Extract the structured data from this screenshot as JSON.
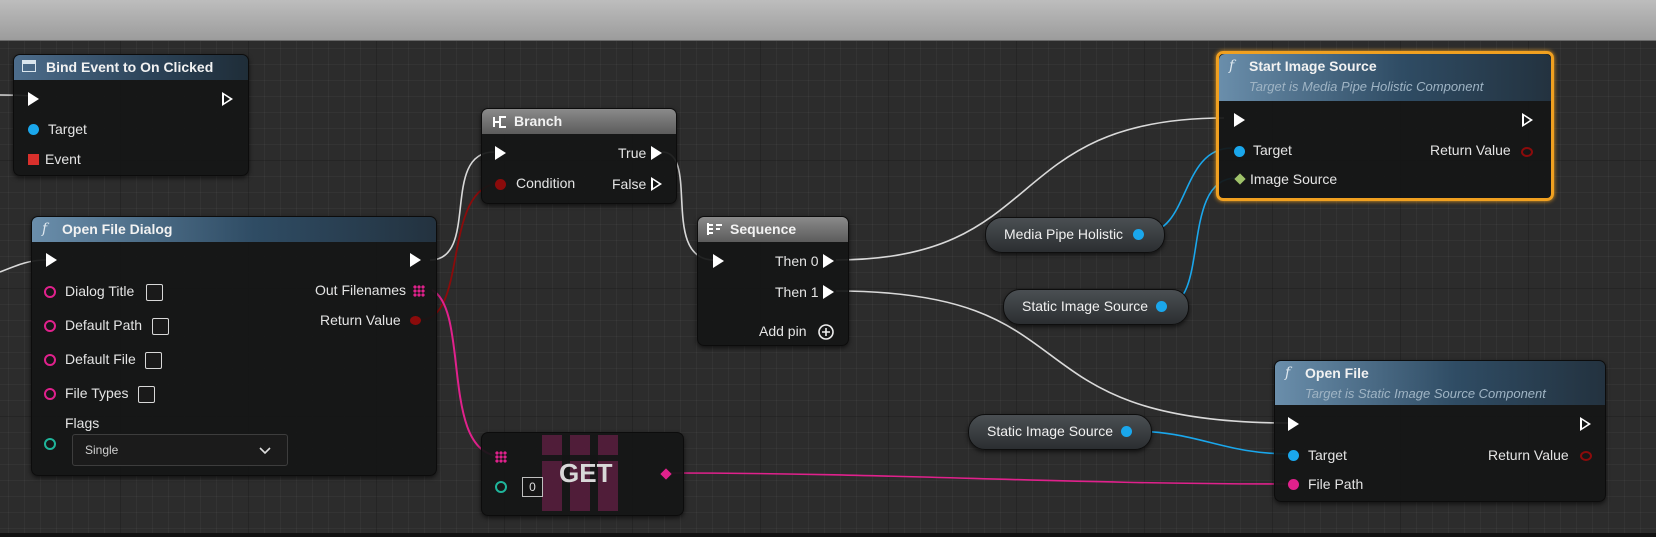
{
  "colors": {
    "exec": "#ffffff",
    "object_pin": "#1aa7ec",
    "string_pin": "#e0218c",
    "bool_pin": "#8b0b0b",
    "int_pin": "#1fb59b",
    "struct_pin": "#9fc26a",
    "selected_border": "#f0a020"
  },
  "nodes": {
    "bind_event": {
      "title": "Bind Event to On Clicked",
      "icon": "event-dispatcher-icon",
      "target_label": "Target",
      "event_label": "Event"
    },
    "open_file_dialog": {
      "title": "Open File Dialog",
      "icon": "function-icon",
      "dialog_title_label": "Dialog Title",
      "default_path_label": "Default Path",
      "default_file_label": "Default File",
      "file_types_label": "File Types",
      "flags_label": "Flags",
      "flags_value": "Single",
      "out_filenames_label": "Out Filenames",
      "return_value_label": "Return Value"
    },
    "branch": {
      "title": "Branch",
      "icon": "branch-icon",
      "condition_label": "Condition",
      "true_label": "True",
      "false_label": "False"
    },
    "sequence": {
      "title": "Sequence",
      "icon": "sequence-icon",
      "then0_label": "Then 0",
      "then1_label": "Then 1",
      "add_pin_label": "Add pin"
    },
    "get": {
      "title": "GET",
      "index_value": "0"
    },
    "start_image_source": {
      "title": "Start Image Source",
      "subtitle": "Target is Media Pipe Holistic Component",
      "icon": "function-icon",
      "target_label": "Target",
      "image_source_label": "Image Source",
      "return_value_label": "Return Value"
    },
    "open_file": {
      "title": "Open File",
      "subtitle": "Target is Static Image Source Component",
      "icon": "function-icon",
      "target_label": "Target",
      "file_path_label": "File Path",
      "return_value_label": "Return Value"
    }
  },
  "variables": {
    "media_pipe_holistic": "Media Pipe Holistic",
    "static_image_source_1": "Static Image Source",
    "static_image_source_2": "Static Image Source"
  }
}
